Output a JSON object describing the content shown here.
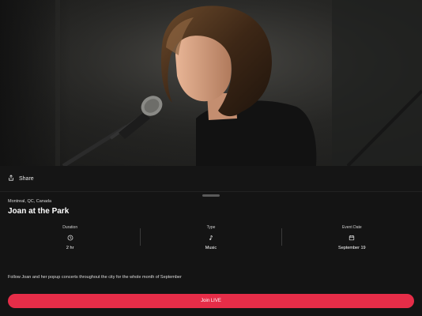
{
  "share": {
    "label": "Share"
  },
  "event": {
    "location": "Montreal, QC, Canada",
    "title": "Joan at the Park",
    "description": "Follow Joan and her popup concerts throughout the city for the whole month of September"
  },
  "stats": [
    {
      "label": "Duration",
      "icon": "clock-icon",
      "value": "2 hr"
    },
    {
      "label": "Type",
      "icon": "music-note-icon",
      "value": "Music"
    },
    {
      "label": "Event Date",
      "icon": "calendar-icon",
      "value": "September 19"
    }
  ],
  "join": {
    "label": "Join LIVE"
  },
  "colors": {
    "accent": "#e62d48",
    "background": "#141414",
    "text": "#ffffff"
  }
}
